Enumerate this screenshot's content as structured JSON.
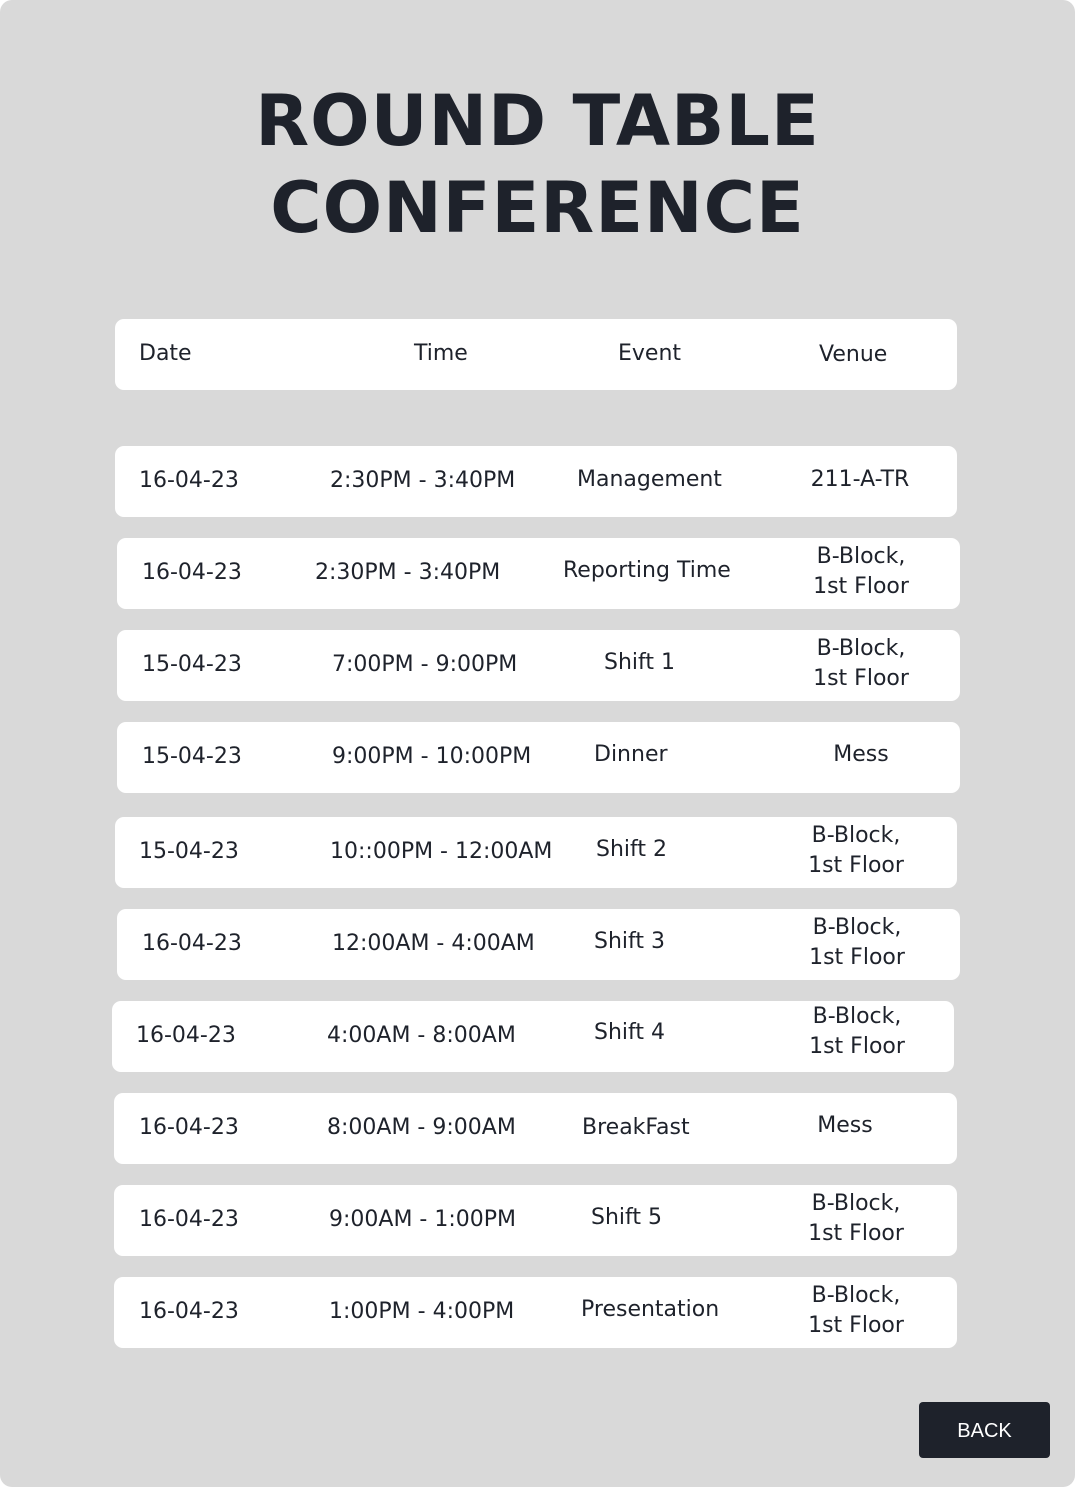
{
  "title": {
    "line1": "ROUND TABLE",
    "line2": "CONFERENCE"
  },
  "headers": {
    "date": "Date",
    "time": "Time",
    "event": "Event",
    "venue": "Venue"
  },
  "rows": [
    {
      "date": "16-04-23",
      "time": "2:30PM - 3:40PM",
      "event": "Management",
      "venue1": "211-A-TR",
      "venue2": ""
    },
    {
      "date": "16-04-23",
      "time": "2:30PM - 3:40PM",
      "event": "Reporting Time",
      "venue1": "B-Block,",
      "venue2": "1st Floor"
    },
    {
      "date": "15-04-23",
      "time": "7:00PM - 9:00PM",
      "event": "Shift 1",
      "venue1": "B-Block,",
      "venue2": "1st Floor"
    },
    {
      "date": "15-04-23",
      "time": "9:00PM - 10:00PM",
      "event": "Dinner",
      "venue1": "Mess",
      "venue2": ""
    },
    {
      "date": "15-04-23",
      "time": "10::00PM - 12:00AM",
      "event": "Shift 2",
      "venue1": "B-Block,",
      "venue2": "1st Floor"
    },
    {
      "date": "16-04-23",
      "time": "12:00AM - 4:00AM",
      "event": "Shift 3",
      "venue1": "B-Block,",
      "venue2": "1st Floor"
    },
    {
      "date": "16-04-23",
      "time": "4:00AM - 8:00AM",
      "event": "Shift 4",
      "venue1": "B-Block,",
      "venue2": "1st Floor"
    },
    {
      "date": "16-04-23",
      "time": "8:00AM - 9:00AM",
      "event": "BreakFast",
      "venue1": "Mess",
      "venue2": ""
    },
    {
      "date": "16-04-23",
      "time": "9:00AM - 1:00PM",
      "event": "Shift 5",
      "venue1": "B-Block,",
      "venue2": "1st Floor"
    },
    {
      "date": "16-04-23",
      "time": "1:00PM - 4:00PM",
      "event": "Presentation",
      "venue1": "B-Block,",
      "venue2": "1st Floor"
    }
  ],
  "back_label": "BACK",
  "colors": {
    "background": "#d9d9d9",
    "card": "#ffffff",
    "text": "#1e222b",
    "button": "#1e222b"
  }
}
